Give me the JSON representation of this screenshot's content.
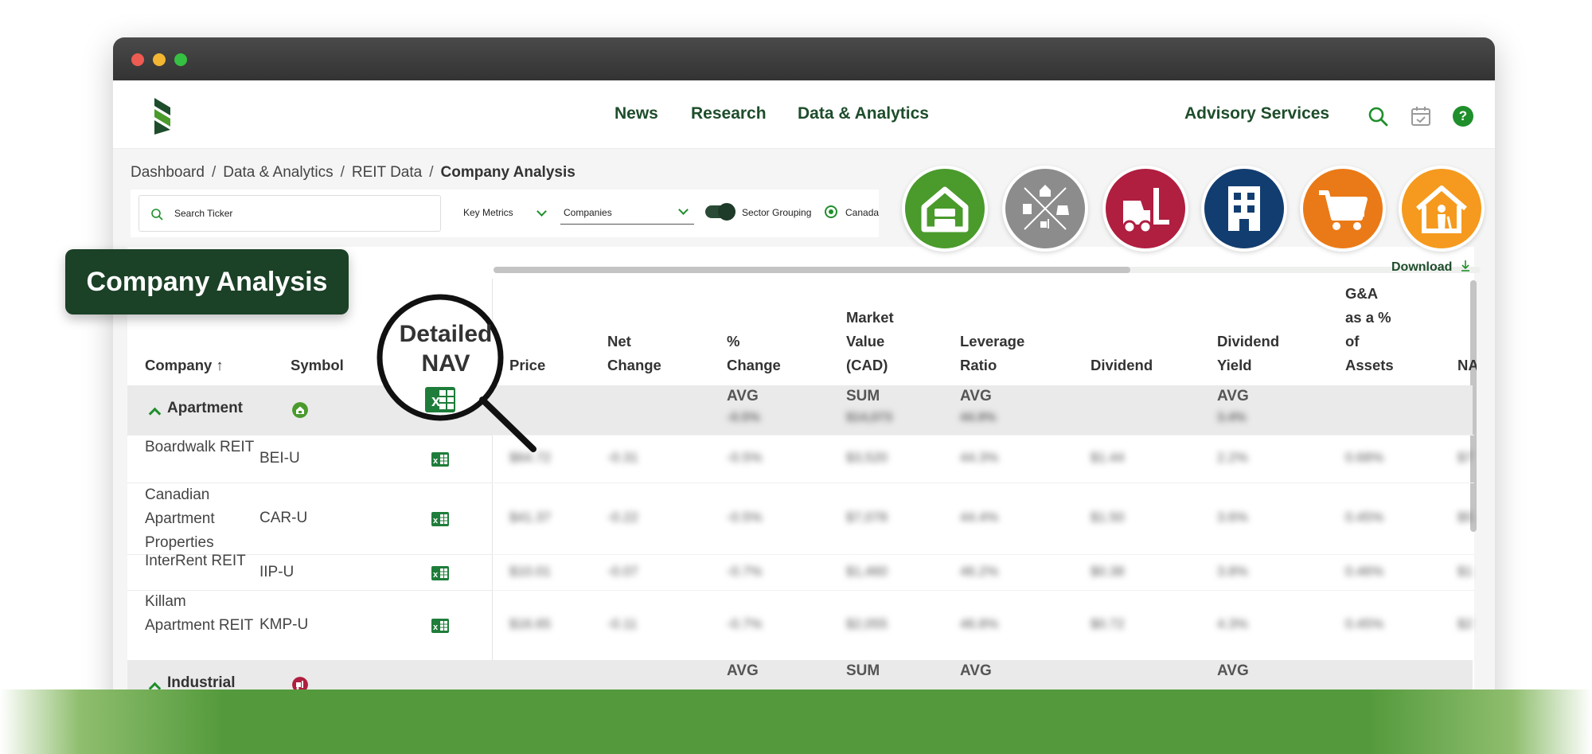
{
  "nav": {
    "news": "News",
    "research": "Research",
    "data_analytics": "Data & Analytics",
    "advisory": "Advisory Services"
  },
  "breadcrumb": {
    "items": [
      "Dashboard",
      "Data & Analytics",
      "REIT Data"
    ],
    "current": "Company Analysis",
    "separator": "/"
  },
  "filters": {
    "search_placeholder": "Search Ticker",
    "key_metrics": "Key Metrics",
    "companies": "Companies",
    "sector_grouping": "Sector Grouping",
    "sector_grouping_on": true,
    "region": "Canada"
  },
  "sectors": [
    {
      "name": "residential-sector-icon",
      "color": "#4a9a2c"
    },
    {
      "name": "diversified-sector-icon",
      "color": "#8c8c8c"
    },
    {
      "name": "industrial-sector-icon",
      "color": "#b01e40"
    },
    {
      "name": "office-sector-icon",
      "color": "#123d70"
    },
    {
      "name": "retail-sector-icon",
      "color": "#ea7a17"
    },
    {
      "name": "seniors-housing-sector-icon",
      "color": "#f59a1e"
    }
  ],
  "download_label": "Download",
  "callout": "Company Analysis",
  "magnifier": {
    "line1": "Detailed",
    "line2": "NAV"
  },
  "table": {
    "headers": {
      "company": "Company ↑",
      "symbol": "Symbol",
      "price": "Price",
      "net_change": [
        "Net",
        "Change"
      ],
      "pct_change": [
        "%",
        "Change"
      ],
      "market_value": [
        "Market",
        "Value",
        "(CAD)"
      ],
      "leverage": [
        "Leverage",
        "Ratio"
      ],
      "dividend": "Dividend",
      "dividend_yield": [
        "Dividend",
        "Yield"
      ],
      "ga": [
        "G&A",
        "as a %",
        "of",
        "Assets"
      ],
      "nav": "NA"
    },
    "groups": [
      {
        "name": "Apartment",
        "agg": {
          "pct_change": "AVG",
          "market_value": "SUM",
          "leverage": "AVG",
          "dividend_yield": "AVG"
        },
        "agg_values": {
          "pct_change": "-0.5%",
          "market_value": "$14,073",
          "leverage": "44.9%",
          "dividend_yield": "3.4%"
        },
        "rows": [
          {
            "company": "Boardwalk REIT",
            "symbol": "BEI-U",
            "price": "$64.72",
            "net_change": "-0.31",
            "pct_change": "-0.5%",
            "market_value": "$3,520",
            "leverage": "44.3%",
            "dividend": "$1.44",
            "dividend_yield": "2.2%",
            "ga": "0.68%",
            "nav": "$7"
          },
          {
            "company": "Canadian Apartment Properties",
            "symbol": "CAR-U",
            "price": "$41.37",
            "net_change": "-0.22",
            "pct_change": "-0.5%",
            "market_value": "$7,078",
            "leverage": "44.4%",
            "dividend": "$1.50",
            "dividend_yield": "3.6%",
            "ga": "0.45%",
            "nav": "$5"
          },
          {
            "company": "InterRent REIT",
            "symbol": "IIP-U",
            "price": "$10.01",
            "net_change": "-0.07",
            "pct_change": "-0.7%",
            "market_value": "$1,460",
            "leverage": "46.2%",
            "dividend": "$0.38",
            "dividend_yield": "3.8%",
            "ga": "0.46%",
            "nav": "$1"
          },
          {
            "company": "Killam Apartment REIT",
            "symbol": "KMP-U",
            "price": "$16.65",
            "net_change": "-0.11",
            "pct_change": "-0.7%",
            "market_value": "$2,055",
            "leverage": "46.8%",
            "dividend": "$0.72",
            "dividend_yield": "4.3%",
            "ga": "0.45%",
            "nav": "$2"
          }
        ]
      },
      {
        "name": "Industrial",
        "agg": {
          "pct_change": "AVG",
          "market_value": "SUM",
          "leverage": "AVG",
          "dividend_yield": "AVG"
        }
      }
    ]
  }
}
